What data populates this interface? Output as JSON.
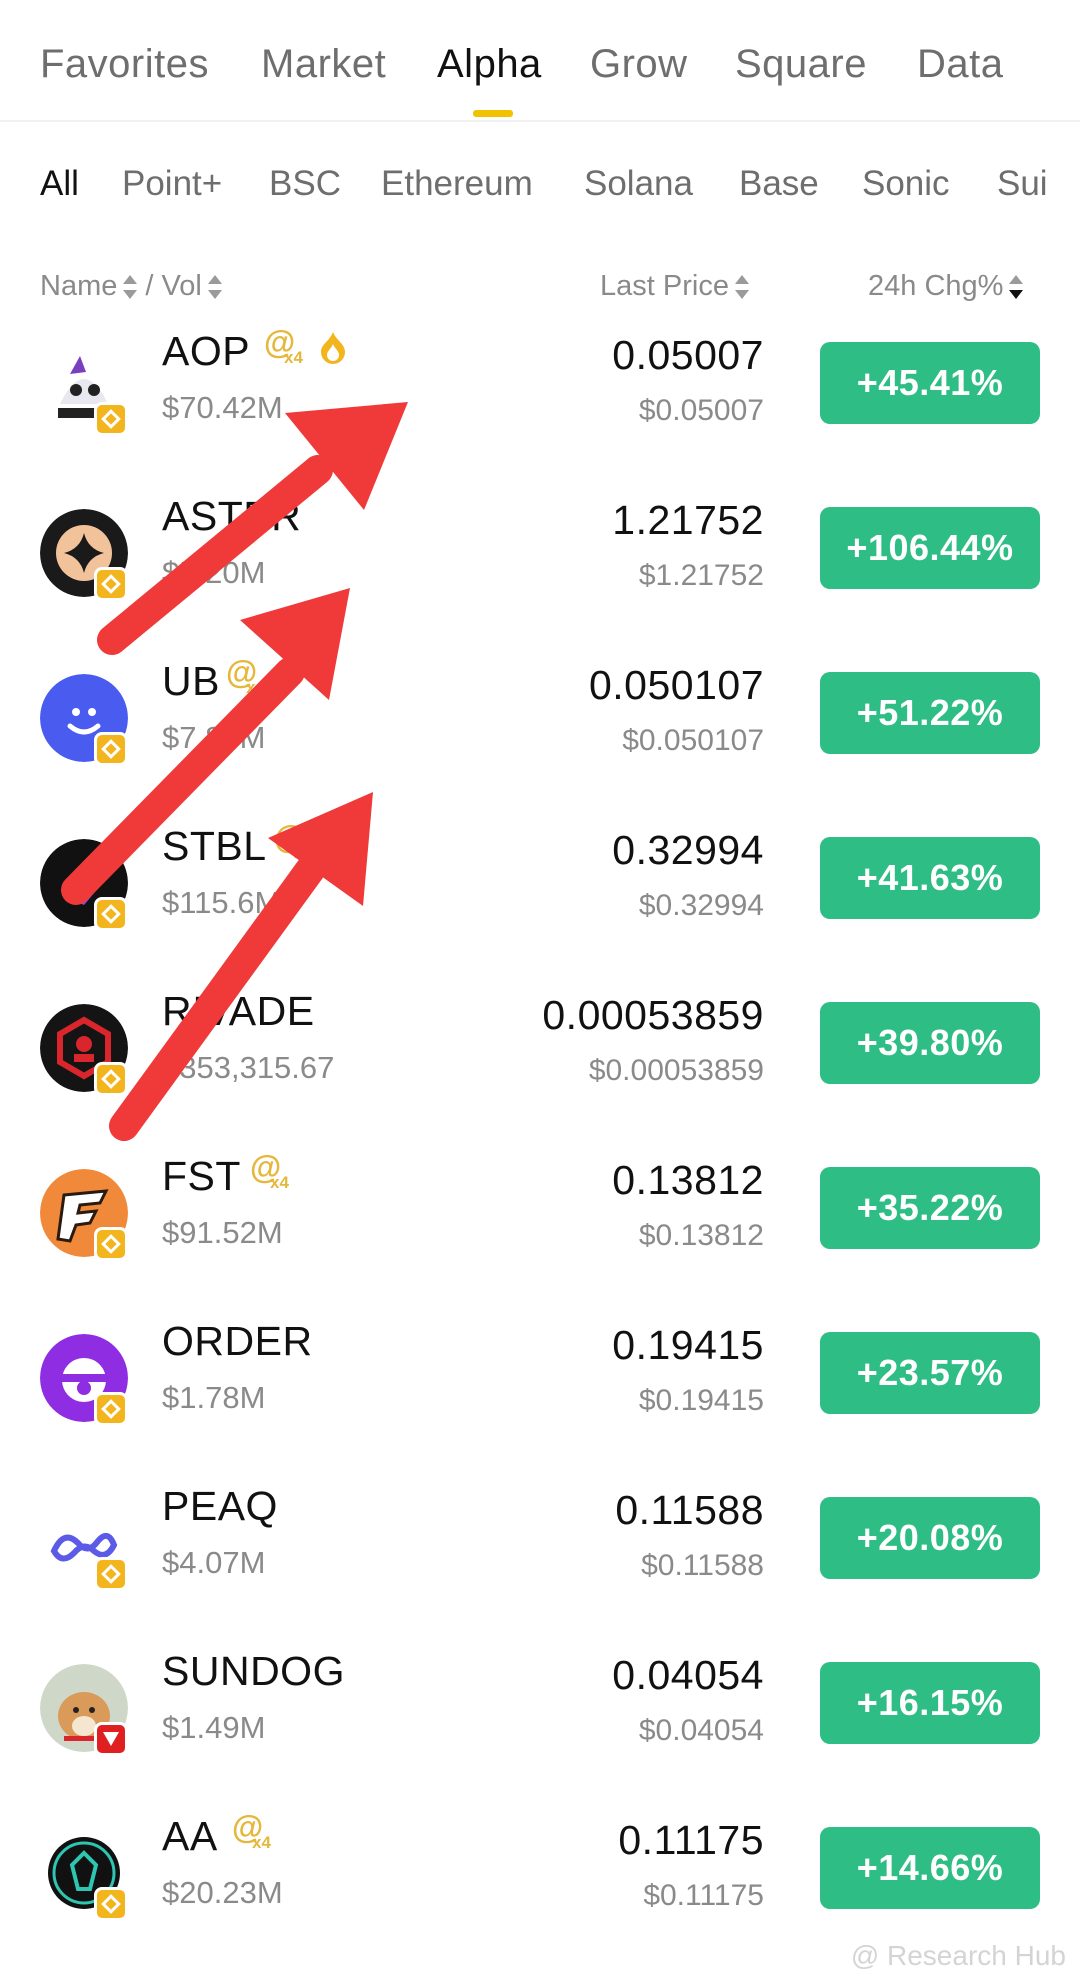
{
  "top_tabs": [
    "Favorites",
    "Market",
    "Alpha",
    "Grow",
    "Square",
    "Data"
  ],
  "top_active": "Alpha",
  "sub_tabs": [
    "All",
    "Point+",
    "BSC",
    "Ethereum",
    "Solana",
    "Base",
    "Sonic",
    "Sui"
  ],
  "sub_active": "All",
  "columns": {
    "name": "Name",
    "separator": "/ Vol",
    "vol": "",
    "price": "Last Price",
    "change": "24h Chg%"
  },
  "badge_text": {
    "at": "@",
    "x4": "x4"
  },
  "rows": [
    {
      "symbol": "AOP",
      "vol": "$70.42M",
      "price": "0.05007",
      "usd": "$0.05007",
      "change": "+45.41%",
      "multiplier": true,
      "hot": true,
      "chain": "bsc"
    },
    {
      "symbol": "ASTER",
      "vol": "$5.20M",
      "price": "1.21752",
      "usd": "$1.21752",
      "change": "+106.44%",
      "multiplier": false,
      "hot": false,
      "chain": "bsc"
    },
    {
      "symbol": "UB",
      "vol": "$7.85M",
      "price": "0.050107",
      "usd": "$0.050107",
      "change": "+51.22%",
      "multiplier": true,
      "hot": false,
      "chain": "bsc"
    },
    {
      "symbol": "STBL",
      "vol": "$115.6M",
      "price": "0.32994",
      "usd": "$0.32994",
      "change": "+41.63%",
      "multiplier": true,
      "hot": false,
      "chain": "bsc"
    },
    {
      "symbol": "RIVADE",
      "vol": "$353,315.67",
      "price": "0.00053859",
      "usd": "$0.00053859",
      "change": "+39.80%",
      "multiplier": false,
      "hot": false,
      "chain": "bsc"
    },
    {
      "symbol": "FST",
      "vol": "$91.52M",
      "price": "0.13812",
      "usd": "$0.13812",
      "change": "+35.22%",
      "multiplier": true,
      "hot": false,
      "chain": "bsc"
    },
    {
      "symbol": "ORDER",
      "vol": "$1.78M",
      "price": "0.19415",
      "usd": "$0.19415",
      "change": "+23.57%",
      "multiplier": false,
      "hot": false,
      "chain": "bsc"
    },
    {
      "symbol": "PEAQ",
      "vol": "$4.07M",
      "price": "0.11588",
      "usd": "$0.11588",
      "change": "+20.08%",
      "multiplier": false,
      "hot": false,
      "chain": "bsc"
    },
    {
      "symbol": "SUNDOG",
      "vol": "$1.49M",
      "price": "0.04054",
      "usd": "$0.04054",
      "change": "+16.15%",
      "multiplier": false,
      "hot": false,
      "chain": "tron"
    },
    {
      "symbol": "AA",
      "vol": "$20.23M",
      "price": "0.11175",
      "usd": "$0.11175",
      "change": "+14.66%",
      "multiplier": true,
      "hot": false,
      "chain": "bsc"
    }
  ],
  "colors": {
    "accent": "#f0c200",
    "positive": "#2ebd85",
    "annotation_arrow": "#f03a3a",
    "badge": "#f3b51d"
  },
  "watermark": "@ Research Hub"
}
